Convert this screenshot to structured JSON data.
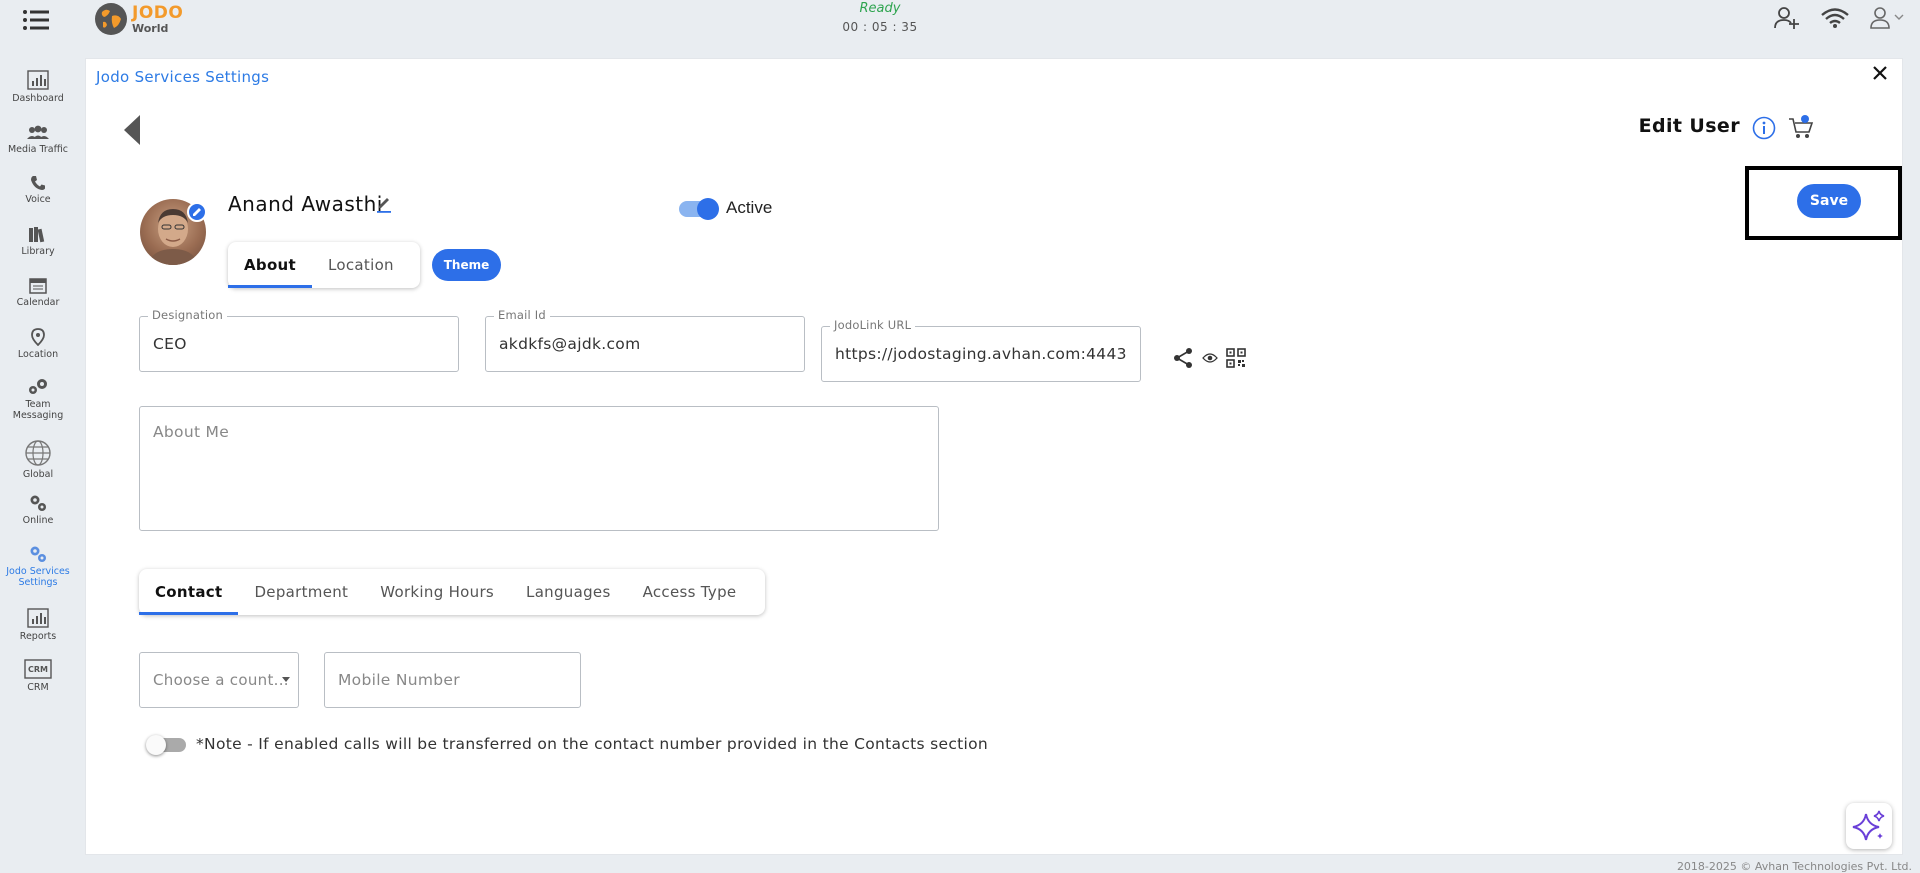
{
  "header": {
    "brand_line1": "JODO",
    "brand_line2": "World",
    "status": "Ready",
    "timer": "00 : 05 : 35"
  },
  "sidebar": {
    "items": [
      {
        "label": "Dashboard",
        "icon": "dashboard-icon"
      },
      {
        "label": "Media Traffic",
        "icon": "users-icon"
      },
      {
        "label": "Voice",
        "icon": "phone-icon"
      },
      {
        "label": "Library",
        "icon": "books-icon"
      },
      {
        "label": "Calendar",
        "icon": "calendar-icon"
      },
      {
        "label": "Location",
        "icon": "location-pin-icon"
      },
      {
        "label": "Team Messaging",
        "icon": "chat-gear-icon"
      },
      {
        "label": "Global",
        "icon": "globe-icon"
      },
      {
        "label": "Online",
        "icon": "gears-icon"
      },
      {
        "label": "Jodo Services Settings",
        "icon": "settings-gears-icon",
        "active": true
      },
      {
        "label": "Reports",
        "icon": "report-icon"
      },
      {
        "label": "CRM",
        "icon": "crm-icon"
      }
    ]
  },
  "panel": {
    "title": "Jodo Services Settings",
    "edit_title": "Edit User",
    "save_label": "Save"
  },
  "profile": {
    "name": "Anand Awasthi",
    "active_label": "Active",
    "active": true,
    "tabs": [
      "About",
      "Location"
    ],
    "selected_tab": "About",
    "theme_label": "Theme"
  },
  "fields": {
    "designation_label": "Designation",
    "designation_value": "CEO",
    "email_label": "Email Id",
    "email_value": "akdkfs@ajdk.com",
    "jodolink_label": "JodoLink URL",
    "jodolink_value": "https://jodostaging.avhan.com:4443",
    "about_placeholder": "About Me"
  },
  "contact": {
    "tabs": [
      "Contact",
      "Department",
      "Working Hours",
      "Languages",
      "Access Type"
    ],
    "selected_tab": "Contact",
    "country_placeholder": "Choose a count...",
    "mobile_placeholder": "Mobile Number",
    "transfer_enabled": false,
    "note": "*Note - If enabled calls will be transferred on the contact number provided in the Contacts section"
  },
  "footer": {
    "copyright": "2018-2025 © Avhan Technologies Pvt. Ltd."
  },
  "colors": {
    "accent": "#2d6fe8",
    "brand_orange": "#f39a2b",
    "status_green": "#2ea44f"
  }
}
